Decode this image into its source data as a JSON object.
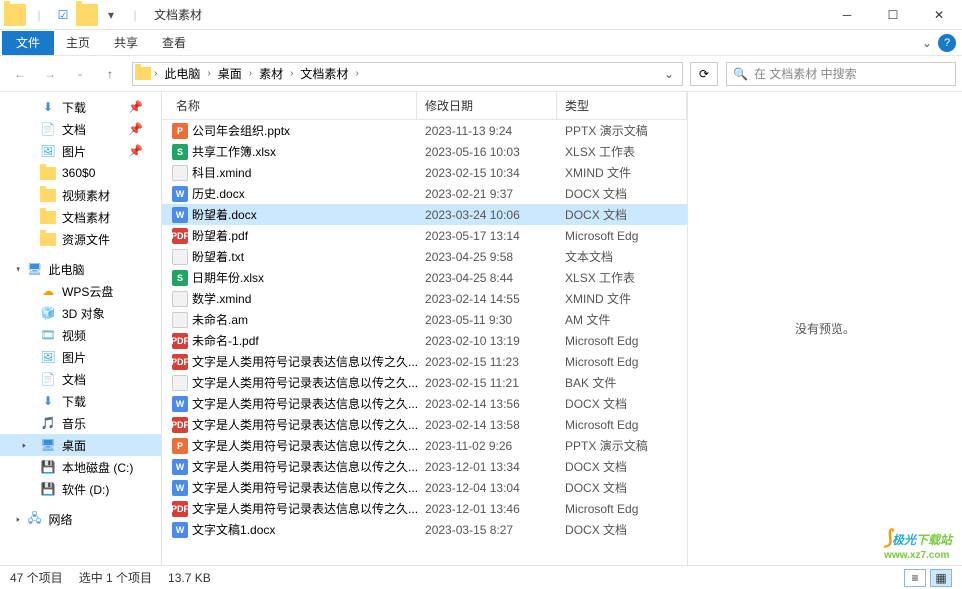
{
  "window": {
    "title": "文档素材",
    "qat_divider": "|"
  },
  "ribbon": {
    "file": "文件",
    "tabs": [
      "主页",
      "共享",
      "查看"
    ],
    "help_tip": "?"
  },
  "nav": {
    "back": "←",
    "forward": "→",
    "up": "↑",
    "crumbs": [
      "此电脑",
      "桌面",
      "素材",
      "文档素材"
    ],
    "search_placeholder": "在 文档素材 中搜索",
    "search_icon": "🔍",
    "refresh": "⟳"
  },
  "tree": {
    "quick": [
      {
        "label": "下载",
        "icon": "download",
        "pin": true
      },
      {
        "label": "文档",
        "icon": "doc",
        "pin": true
      },
      {
        "label": "图片",
        "icon": "pic",
        "pin": true
      },
      {
        "label": "360$0",
        "icon": "folder",
        "pin": false
      },
      {
        "label": "视频素材",
        "icon": "folder",
        "pin": false
      },
      {
        "label": "文档素材",
        "icon": "folder",
        "pin": false
      },
      {
        "label": "资源文件",
        "icon": "folder",
        "pin": false
      }
    ],
    "thispc_label": "此电脑",
    "thispc": [
      {
        "label": "WPS云盘",
        "icon": "wps"
      },
      {
        "label": "3D 对象",
        "icon": "3d"
      },
      {
        "label": "视频",
        "icon": "video"
      },
      {
        "label": "图片",
        "icon": "pic"
      },
      {
        "label": "文档",
        "icon": "doc"
      },
      {
        "label": "下载",
        "icon": "download"
      },
      {
        "label": "音乐",
        "icon": "music"
      },
      {
        "label": "桌面",
        "icon": "desktop",
        "selected": true
      },
      {
        "label": "本地磁盘 (C:)",
        "icon": "drive"
      },
      {
        "label": "软件 (D:)",
        "icon": "drive"
      }
    ],
    "network_label": "网络"
  },
  "columns": {
    "name": "名称",
    "date": "修改日期",
    "type": "类型"
  },
  "files": [
    {
      "name": "公司年会组织.pptx",
      "date": "2023-11-13 9:24",
      "type": "PPTX 演示文稿",
      "icon": "pptx"
    },
    {
      "name": "共享工作簿.xlsx",
      "date": "2023-05-16 10:03",
      "type": "XLSX 工作表",
      "icon": "xlsx"
    },
    {
      "name": "科目.xmind",
      "date": "2023-02-15 10:34",
      "type": "XMIND 文件",
      "icon": "xmind"
    },
    {
      "name": "历史.docx",
      "date": "2023-02-21 9:37",
      "type": "DOCX 文档",
      "icon": "docx"
    },
    {
      "name": "盼望着.docx",
      "date": "2023-03-24 10:06",
      "type": "DOCX 文档",
      "icon": "docx",
      "selected": true
    },
    {
      "name": "盼望着.pdf",
      "date": "2023-05-17 13:14",
      "type": "Microsoft Edg",
      "icon": "pdf"
    },
    {
      "name": "盼望着.txt",
      "date": "2023-04-25 9:58",
      "type": "文本文档",
      "icon": "txt"
    },
    {
      "name": "日期年份.xlsx",
      "date": "2023-04-25 8:44",
      "type": "XLSX 工作表",
      "icon": "xlsx"
    },
    {
      "name": "数学.xmind",
      "date": "2023-02-14 14:55",
      "type": "XMIND 文件",
      "icon": "xmind"
    },
    {
      "name": "未命名.am",
      "date": "2023-05-11 9:30",
      "type": "AM 文件",
      "icon": "am"
    },
    {
      "name": "未命名-1.pdf",
      "date": "2023-02-10 13:19",
      "type": "Microsoft Edg",
      "icon": "pdf"
    },
    {
      "name": "文字是人类用符号记录表达信息以传之久...",
      "date": "2023-02-15 11:23",
      "type": "Microsoft Edg",
      "icon": "pdf"
    },
    {
      "name": "文字是人类用符号记录表达信息以传之久...",
      "date": "2023-02-15 11:21",
      "type": "BAK 文件",
      "icon": "bak"
    },
    {
      "name": "文字是人类用符号记录表达信息以传之久...",
      "date": "2023-02-14 13:56",
      "type": "DOCX 文档",
      "icon": "docx"
    },
    {
      "name": "文字是人类用符号记录表达信息以传之久...",
      "date": "2023-02-14 13:58",
      "type": "Microsoft Edg",
      "icon": "pdf"
    },
    {
      "name": "文字是人类用符号记录表达信息以传之久...",
      "date": "2023-11-02 9:26",
      "type": "PPTX 演示文稿",
      "icon": "pptx"
    },
    {
      "name": "文字是人类用符号记录表达信息以传之久...",
      "date": "2023-12-01 13:34",
      "type": "DOCX 文档",
      "icon": "docx"
    },
    {
      "name": "文字是人类用符号记录表达信息以传之久...",
      "date": "2023-12-04 13:04",
      "type": "DOCX 文档",
      "icon": "docx"
    },
    {
      "name": "文字是人类用符号记录表达信息以传之久...",
      "date": "2023-12-01 13:46",
      "type": "Microsoft Edg",
      "icon": "pdf"
    },
    {
      "name": "文字文稿1.docx",
      "date": "2023-03-15 8:27",
      "type": "DOCX 文档",
      "icon": "docx"
    }
  ],
  "preview": {
    "empty": "没有预览。"
  },
  "status": {
    "count": "47 个项目",
    "selected": "选中 1 个项目",
    "size": "13.7 KB"
  },
  "watermark": {
    "a": "极光",
    "b": "下载站",
    "url": "www.xz7.com"
  },
  "icon_glyphs": {
    "pptx": "P",
    "xlsx": "S",
    "docx": "W",
    "pdf": "PDF",
    "txt": "",
    "xmind": "",
    "am": "",
    "bak": ""
  },
  "tree_glyphs": {
    "download": "⬇",
    "doc": "📄",
    "pic": "🖼",
    "folder": "",
    "wps": "☁",
    "3d": "🧊",
    "video": "🎞",
    "music": "🎵",
    "desktop": "🖥",
    "drive": "💾",
    "network": "🖧",
    "pc": "🖥"
  }
}
